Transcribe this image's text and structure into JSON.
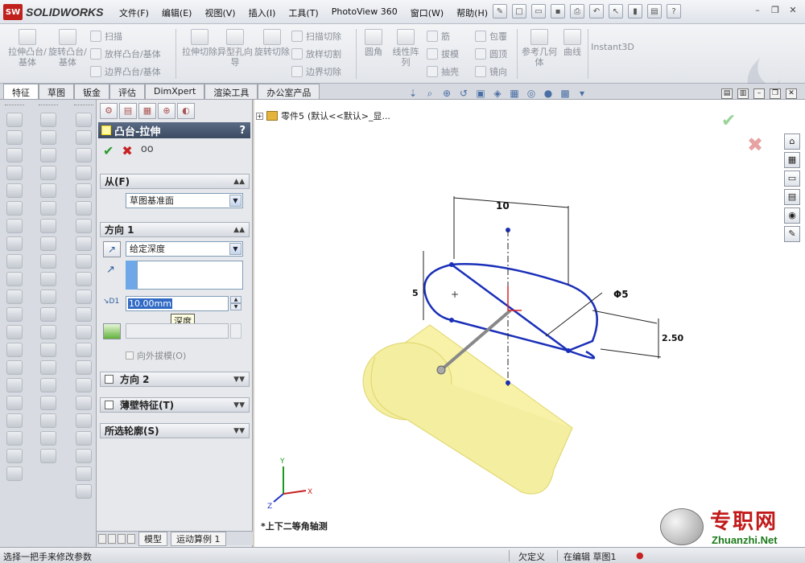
{
  "app": {
    "brand": "SOLIDWORKS",
    "logo_text": "SW"
  },
  "menu": [
    "文件(F)",
    "编辑(E)",
    "视图(V)",
    "插入(I)",
    "工具(T)",
    "PhotoView 360",
    "窗口(W)",
    "帮助(H)"
  ],
  "ribbon": {
    "extrude_boss": "拉伸凸台/基体",
    "revolve_boss": "旋转凸台/基体",
    "sweep": "扫描",
    "loft_boss": "放样凸台/基体",
    "boundary_boss": "边界凸台/基体",
    "extrude_cut": "拉伸切除",
    "hole_wizard": "异型孔向导",
    "revolve_cut": "旋转切除",
    "sweep_cut": "扫描切除",
    "loft_cut": "放样切割",
    "boundary_cut": "边界切除",
    "fillet": "圆角",
    "linear_pattern": "线性阵列",
    "rib": "筋",
    "draft": "拔模",
    "shell": "抽壳",
    "wrap": "包覆",
    "dome": "圆顶",
    "mirror": "镜向",
    "reference_geometry": "参考几何体",
    "curves": "曲线",
    "instant3d": "Instant3D"
  },
  "tabs": [
    "特征",
    "草图",
    "钣金",
    "评估",
    "DimXpert",
    "渲染工具",
    "办公室产品"
  ],
  "tree": {
    "item": "零件5",
    "config": "(默认<<默认>_显..."
  },
  "pm": {
    "title": "凸台-拉伸",
    "help": "?",
    "from_label": "从(F)",
    "from_value": "草图基准面",
    "dir1_label": "方向 1",
    "dir1_type": "给定深度",
    "depth_value": "10.00mm",
    "depth_tooltip": "深度",
    "draft_outward": "向外拔模(O)",
    "dir2_label": "方向 2",
    "thin_label": "薄壁特征(T)",
    "contours_label": "所选轮廓(S)",
    "d1_label": "D1"
  },
  "model_tabs": [
    "模型",
    "运动算例 1"
  ],
  "graphics": {
    "view_label": "*上下二等角轴测",
    "dim_width": "10",
    "dim_dia": "Φ5",
    "dim_height": "5",
    "dim_side": "2.50"
  },
  "watermark": {
    "cn": "专职网",
    "en": "Zhuanzhi.Net"
  },
  "status": {
    "hint": "选择一把手来修改参数",
    "state": "欠定义",
    "editing": "在编辑 草图1"
  },
  "colors": {
    "accent_red": "#c0211d",
    "sketch_blue": "#1a2fb8",
    "body_yellow": "#f7f2a8"
  }
}
